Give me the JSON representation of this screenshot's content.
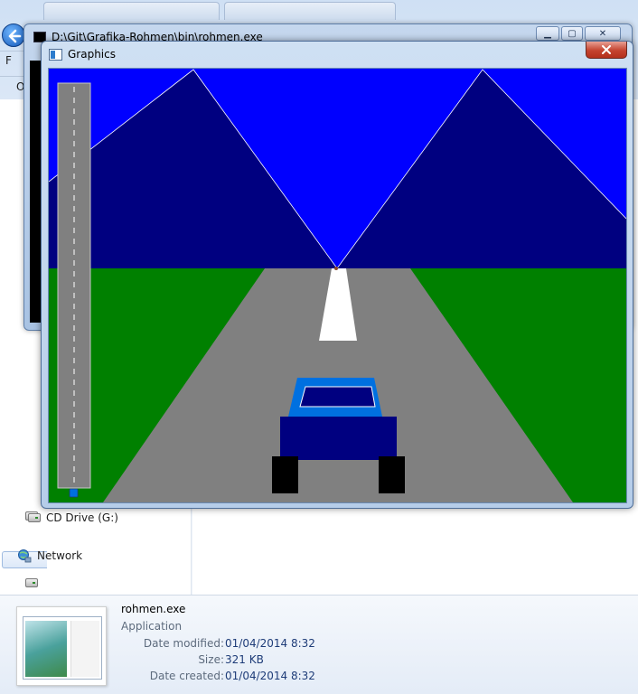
{
  "console_window": {
    "title": "D:\\Git\\Grafika-Rohmen\\bin\\rohmen.exe"
  },
  "graphics_window": {
    "title": "Graphics",
    "scene": {
      "sky_color": "#0000ff",
      "mountain_color": "#000080",
      "grass_color": "#008000",
      "road_color": "#808080",
      "lane_marker_color": "#ffffff",
      "car_body_color": "#000080",
      "car_cabin_color": "#0070e0",
      "wheel_color": "#000000",
      "progress_marker_color": "#0070e0",
      "progress_fraction": 0.0
    }
  },
  "explorer": {
    "menu_letter": "F",
    "org_letter": "O",
    "nav": {
      "drive_label": "CD Drive (G:)",
      "network_label": "Network"
    },
    "details": {
      "file_name": "rohmen.exe",
      "file_type": "Application",
      "rows": [
        {
          "key": "Date modified:",
          "value": "01/04/2014 8:32"
        },
        {
          "key": "Size:",
          "value": "321 KB"
        },
        {
          "key": "Date created:",
          "value": "01/04/2014 8:32"
        }
      ]
    }
  },
  "icons": [
    "back-arrow-icon",
    "console-app-icon",
    "window-app-icon",
    "close-icon",
    "minimize-icon",
    "maximize-icon",
    "drive-icon",
    "network-icon",
    "file-thumbnail-icon"
  ]
}
